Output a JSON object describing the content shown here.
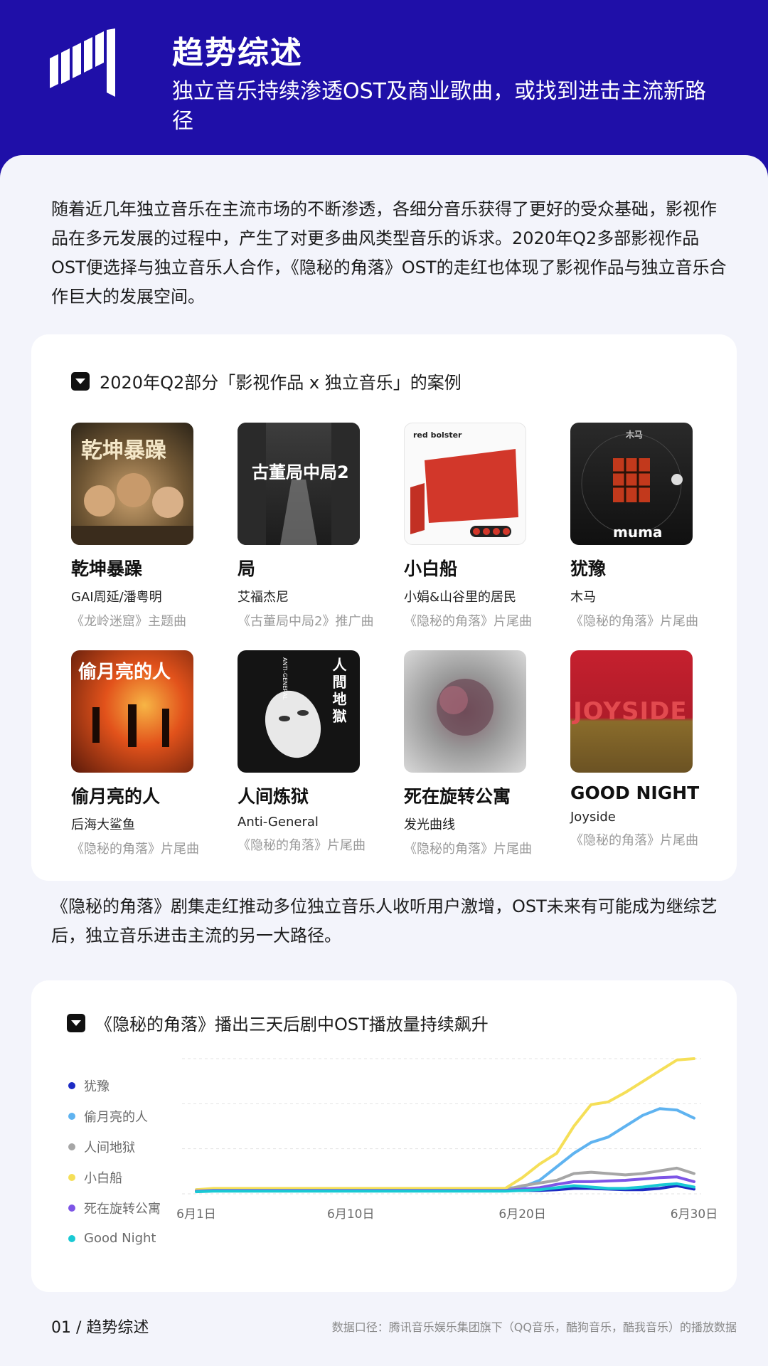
{
  "header": {
    "title": "趋势综述",
    "subtitle": "独立音乐持续渗透OST及商业歌曲，或找到进击主流新路径"
  },
  "intro": "随着近几年独立音乐在主流市场的不断渗透，各细分音乐获得了更好的受众基础，影视作品在多元发展的过程中，产生了对更多曲风类型音乐的诉求。2020年Q2多部影视作品OST便选择与独立音乐人合作，《隐秘的角落》OST的走红也体现了影视作品与独立音乐合作巨大的发展空间。",
  "cases_card": {
    "title": "2020年Q2部分「影视作品 x 独立音乐」的案例",
    "albums": [
      {
        "title": "乾坤暴躁",
        "artist": "GAI周延/潘粤明",
        "note": "《龙岭迷窟》主题曲"
      },
      {
        "title": "局",
        "artist": "艾福杰尼",
        "note": "《古董局中局2》推广曲"
      },
      {
        "title": "小白船",
        "artist": "小娟&山谷里的居民",
        "note": "《隐秘的角落》片尾曲"
      },
      {
        "title": "犹豫",
        "artist": "木马",
        "note": "《隐秘的角落》片尾曲"
      },
      {
        "title": "偷月亮的人",
        "artist": "后海大鲨鱼",
        "note": "《隐秘的角落》片尾曲"
      },
      {
        "title": "人间炼狱",
        "artist": "Anti-General",
        "note": "《隐秘的角落》片尾曲"
      },
      {
        "title": "死在旋转公寓",
        "artist": "发光曲线",
        "note": "《隐秘的角落》片尾曲"
      },
      {
        "title": "GOOD NIGHT",
        "artist": "Joyside",
        "note": "《隐秘的角落》片尾曲"
      }
    ],
    "cover_texts": {
      "c1": "乾坤暴躁",
      "c2": "古董局中局2",
      "c3a": "red bolster",
      "c4a": "木马",
      "c4b": "muma",
      "c5": "偷月亮的人",
      "c6": "人間地獄",
      "c6b": "ANTI-GENERAL",
      "c8": "JOYSIDE"
    }
  },
  "between_text": "《隐秘的角落》剧集走红推动多位独立音乐人收听用户激增，OST未来有可能成为继综艺后，独立音乐进击主流的另一大路径。",
  "chart_card": {
    "title": "《隐秘的角落》播出三天后剧中OST播放量持续飙升"
  },
  "chart_data": {
    "type": "line",
    "title": "《隐秘的角落》播出三天后剧中OST播放量持续飙升",
    "x": [
      1,
      2,
      3,
      4,
      5,
      6,
      7,
      8,
      9,
      10,
      11,
      12,
      13,
      14,
      15,
      16,
      17,
      18,
      19,
      20,
      21,
      22,
      23,
      24,
      25,
      26,
      27,
      28,
      29,
      30
    ],
    "x_tick_labels": [
      "6月1日",
      "6月10日",
      "6月20日",
      "6月30日"
    ],
    "x_tick_values": [
      1,
      10,
      20,
      30
    ],
    "ylim": [
      0,
      100
    ],
    "grid": "horizontal dashed",
    "legend": "left",
    "series": [
      {
        "name": "犹豫",
        "color": "#1d2bc4",
        "values": [
          2,
          2.5,
          2.5,
          2.5,
          2.5,
          2.5,
          2.5,
          2.5,
          2.5,
          2.5,
          2.5,
          2.5,
          2.5,
          2.5,
          2.5,
          2.5,
          2.5,
          2.5,
          2.5,
          2.5,
          2.5,
          3,
          4,
          4,
          3.5,
          3,
          3,
          4,
          6,
          3.5
        ]
      },
      {
        "name": "偷月亮的人",
        "color": "#5fb3f0",
        "values": [
          3,
          3.5,
          3.5,
          3.5,
          3.5,
          3.5,
          3.5,
          3.5,
          3.5,
          3.5,
          3.5,
          3.5,
          3.5,
          3.5,
          3.5,
          3.5,
          3.5,
          3.5,
          4,
          5,
          10,
          20,
          30,
          38,
          42,
          50,
          58,
          63,
          62,
          56
        ]
      },
      {
        "name": "人间地狱",
        "color": "#a6a6a6",
        "values": [
          2.5,
          3,
          3,
          3,
          3,
          3,
          3,
          3,
          3,
          3,
          3,
          3,
          3,
          3,
          3,
          3,
          3,
          3,
          3,
          6,
          8,
          10,
          15,
          16,
          15,
          14,
          15,
          17,
          19,
          15
        ]
      },
      {
        "name": "小白船",
        "color": "#f5df58",
        "values": [
          3,
          4,
          4,
          4,
          4,
          4,
          4,
          4,
          4,
          4,
          4,
          4,
          4,
          4,
          4,
          4,
          4,
          4,
          4,
          12,
          22,
          30,
          50,
          66,
          68,
          75,
          83,
          91,
          99,
          100
        ]
      },
      {
        "name": "死在旋转公寓",
        "color": "#7d55e6",
        "values": [
          2,
          2.5,
          2.5,
          2.5,
          2.5,
          2.5,
          2.5,
          2.5,
          2.5,
          2.5,
          2.5,
          2.5,
          2.5,
          2.5,
          2.5,
          2.5,
          2.5,
          2.5,
          2.5,
          3.5,
          4.5,
          7,
          9,
          9,
          9.5,
          10,
          11,
          12,
          12.5,
          9
        ]
      },
      {
        "name": "Good Night",
        "color": "#19c9d4",
        "values": [
          1.5,
          2,
          2,
          2,
          2,
          2,
          2,
          2,
          2,
          2,
          2,
          2,
          2,
          2,
          2,
          2,
          2,
          2,
          2,
          2.5,
          3,
          4.5,
          6,
          5,
          4,
          4,
          5,
          6.5,
          7.5,
          5
        ]
      }
    ]
  },
  "footer": {
    "left": "01 / 趋势综述",
    "right": "数据口径：腾讯音乐娱乐集团旗下（QQ音乐，酷狗音乐，酷我音乐）的播放数据"
  }
}
